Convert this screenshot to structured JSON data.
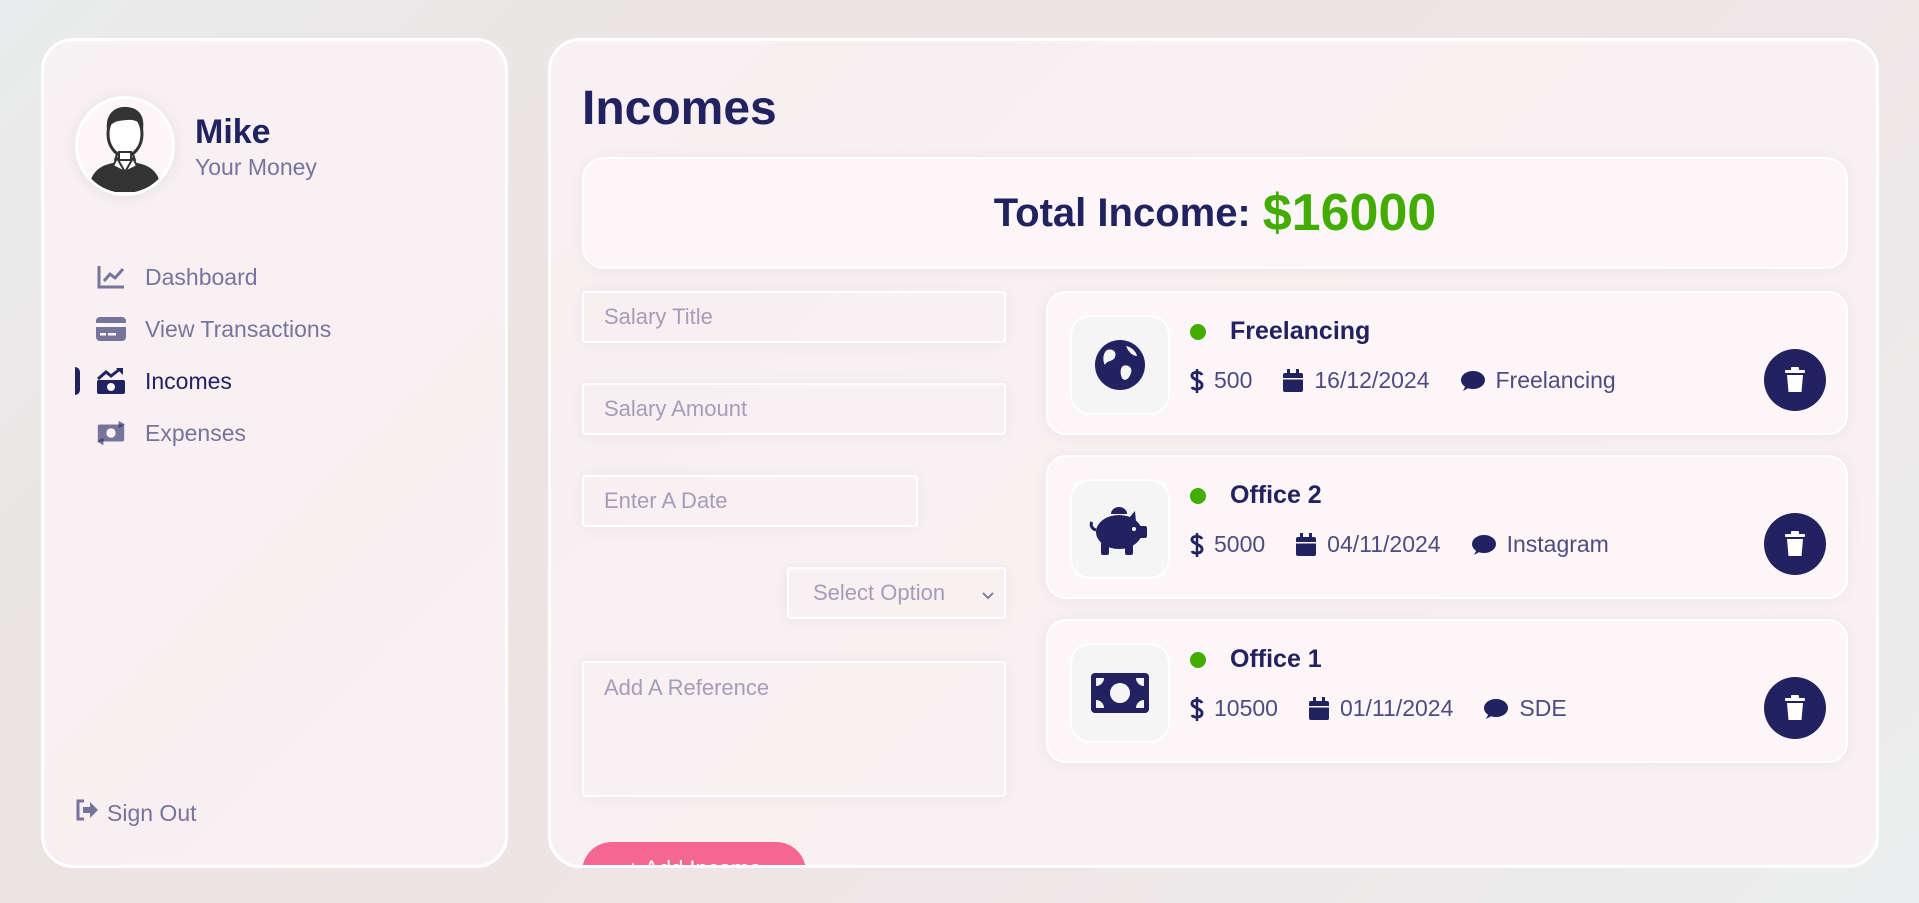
{
  "user": {
    "name": "Mike",
    "subtitle": "Your Money"
  },
  "menu": [
    {
      "label": "Dashboard",
      "icon": "chart-line-icon",
      "active": false
    },
    {
      "label": "View Transactions",
      "icon": "credit-card-icon",
      "active": false
    },
    {
      "label": "Incomes",
      "icon": "money-bill-trend-up-icon",
      "active": true
    },
    {
      "label": "Expenses",
      "icon": "money-bill-transfer-icon",
      "active": false
    }
  ],
  "signout": {
    "label": "Sign Out",
    "icon": "sign-out-icon"
  },
  "page": {
    "title": "Incomes"
  },
  "total": {
    "label": "Total Income:",
    "amount": "$16000"
  },
  "form": {
    "title_placeholder": "Salary Title",
    "amount_placeholder": "Salary Amount",
    "date_placeholder": "Enter A Date",
    "select_value": "Select Option",
    "reference_placeholder": "Add A Reference",
    "submit_label": "+ Add Income"
  },
  "incomes": [
    {
      "title": "Freelancing",
      "amount": "500",
      "date": "16/12/2024",
      "description": "Freelancing",
      "icon": "globe-icon"
    },
    {
      "title": "Office 2",
      "amount": "5000",
      "date": "04/11/2024",
      "description": "Instagram",
      "icon": "piggy-bank-icon"
    },
    {
      "title": "Office 1",
      "amount": "10500",
      "date": "01/11/2024",
      "description": "SDE",
      "icon": "money-bill-icon"
    }
  ],
  "colors": {
    "primary": "#222260",
    "income_green": "#42ad00",
    "accent_pink": "#f56692"
  }
}
